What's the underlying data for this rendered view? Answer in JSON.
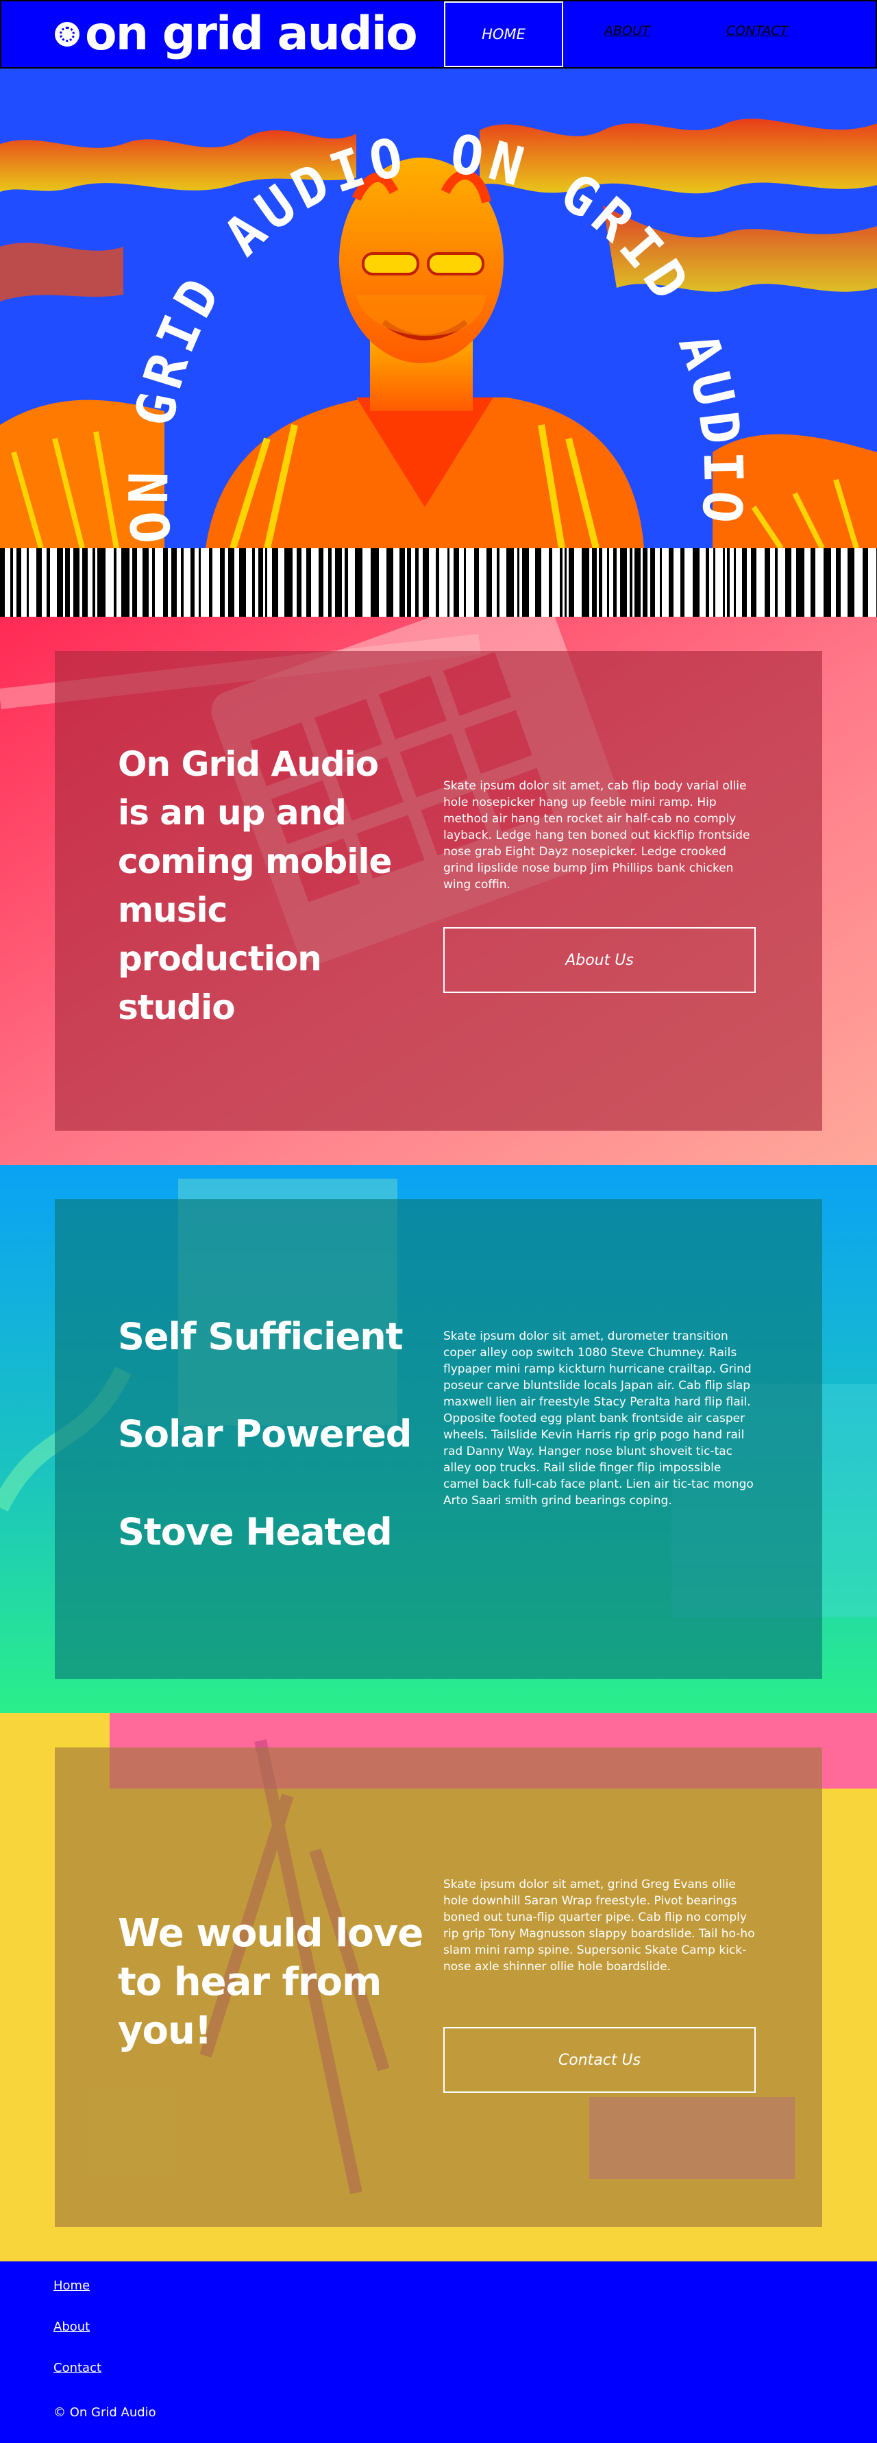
{
  "brand": {
    "name": "on grid audio"
  },
  "nav": {
    "home": "HOME",
    "about": "ABOUT",
    "contact": "CONTACT"
  },
  "hero": {
    "arc_text": "ON GRID AUDIO ON GRID AUDIO"
  },
  "section1": {
    "heading_lines": [
      "On Grid Audio",
      "is an up and",
      "coming mobile",
      "music",
      "production",
      "studio"
    ],
    "body": "Skate ipsum dolor sit amet, cab flip body varial ollie hole nosepicker hang up feeble mini ramp. Hip method air hang ten rocket air half-cab no comply layback. Ledge hang ten boned out kickflip frontside nose grab Eight Dayz nosepicker. Ledge crooked grind lipslide nose bump Jim Phillips bank chicken wing coffin.",
    "cta": "About Us"
  },
  "section2": {
    "features": [
      "Self Sufficient",
      "Solar Powered",
      "Stove Heated"
    ],
    "body": "Skate ipsum dolor sit amet, durometer transition coper alley oop switch 1080 Steve Chumney. Rails flypaper mini ramp kickturn hurricane crailtap. Grind poseur carve bluntslide locals Japan air. Cab flip slap maxwell lien air freestyle Stacy Peralta hard flip flail. Opposite footed egg plant bank frontside air casper wheels. Tailslide Kevin Harris rip grip pogo hand rail rad Danny Way. Hanger nose blunt shoveit tic-tac alley oop trucks. Rail slide finger flip impossible camel back full-cab face plant. Lien air tic-tac mongo Arto Saari smith grind bearings coping."
  },
  "section3": {
    "heading_lines": [
      "We would love",
      "to hear from",
      "you!"
    ],
    "body": "Skate ipsum dolor sit amet, grind Greg Evans ollie hole downhill Saran Wrap freestyle. Pivot bearings boned out tuna-flip quarter pipe. Cab flip no comply rip grip Tony Magnusson slappy boardslide. Tail ho-ho slam mini ramp spine. Supersonic Skate Camp kick-nose axle shinner ollie hole boardslide.",
    "cta": "Contact Us"
  },
  "footer": {
    "links": [
      "Home",
      "About",
      "Contact"
    ],
    "copyright": "© On Grid Audio"
  },
  "colors": {
    "brand_blue": "#0000ff",
    "section1_bg": "#ff4f6b",
    "section2_bg": "#1aa3f0",
    "section3_bg": "#f7d23a"
  }
}
